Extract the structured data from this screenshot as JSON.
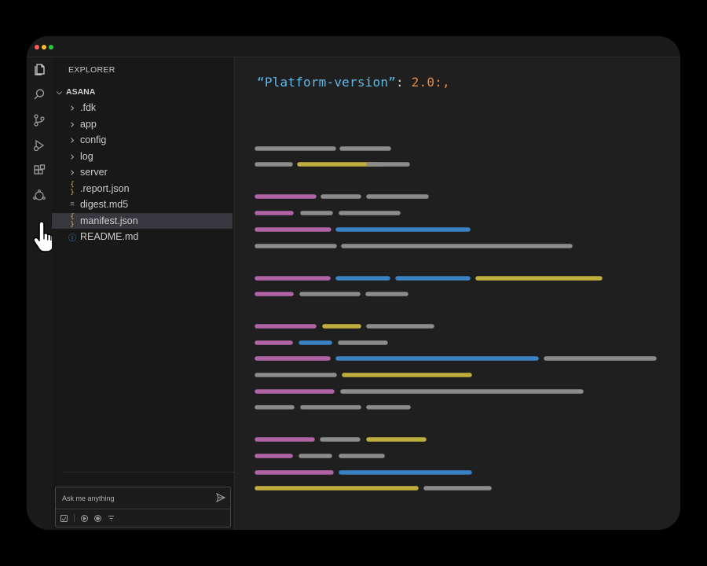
{
  "sidebar": {
    "title": "EXPLORER",
    "root": "ASANA",
    "items": [
      {
        "label": ".fdk",
        "kind": "folder",
        "icon": "chevron-right-icon"
      },
      {
        "label": "app",
        "kind": "folder",
        "icon": "chevron-right-icon"
      },
      {
        "label": "config",
        "kind": "folder",
        "icon": "chevron-right-icon"
      },
      {
        "label": "log",
        "kind": "folder",
        "icon": "chevron-right-icon"
      },
      {
        "label": "server",
        "kind": "folder",
        "icon": "chevron-right-icon"
      },
      {
        "label": ".report.json",
        "kind": "json",
        "icon": "json-file-icon"
      },
      {
        "label": "digest.md5",
        "kind": "md5",
        "icon": "text-file-icon"
      },
      {
        "label": "manifest.json",
        "kind": "json",
        "icon": "json-file-icon",
        "selected": true
      },
      {
        "label": "README.md",
        "kind": "info",
        "icon": "info-file-icon"
      }
    ]
  },
  "activity_bar": [
    "files-icon",
    "search-icon",
    "source-control-icon",
    "run-debug-icon",
    "extensions-icon",
    "ai-assistant-icon"
  ],
  "chat": {
    "placeholder": "Ask me anything",
    "tools": [
      "attach-icon",
      "play-icon",
      "record-icon",
      "filter-icon"
    ]
  },
  "editor": {
    "key": "“Platform-version”",
    "colon": ": ",
    "value": "2.0:,",
    "bar_colors": {
      "g": "#8c8c8c",
      "p": "#b064a6",
      "b": "#3a82c4",
      "y": "#bfae3d"
    }
  }
}
